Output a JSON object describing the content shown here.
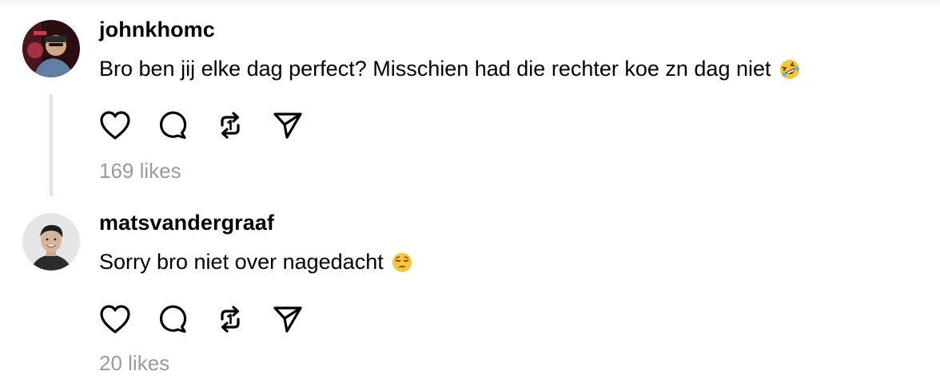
{
  "comments": [
    {
      "username": "johnkhomc",
      "text": "Bro ben jij elke dag perfect? Misschien had die rechter koe zn dag niet",
      "emoji": "rolling-on-the-floor-laughing",
      "likes": "169 likes",
      "avatar_bg": "#3a1418"
    },
    {
      "username": "matsvandergraaf",
      "text": "Sorry bro niet over nagedacht",
      "emoji": "pensive-face",
      "likes": "20 likes",
      "avatar_bg": "#e6e6e6"
    }
  ],
  "icons": [
    "heart-icon",
    "comment-icon",
    "repost-icon",
    "share-icon"
  ],
  "colors": {
    "text": "#000000",
    "muted": "#9a9a9a",
    "thread_line": "#e3e3e3",
    "emoji_yellow": "#f7c43c"
  }
}
